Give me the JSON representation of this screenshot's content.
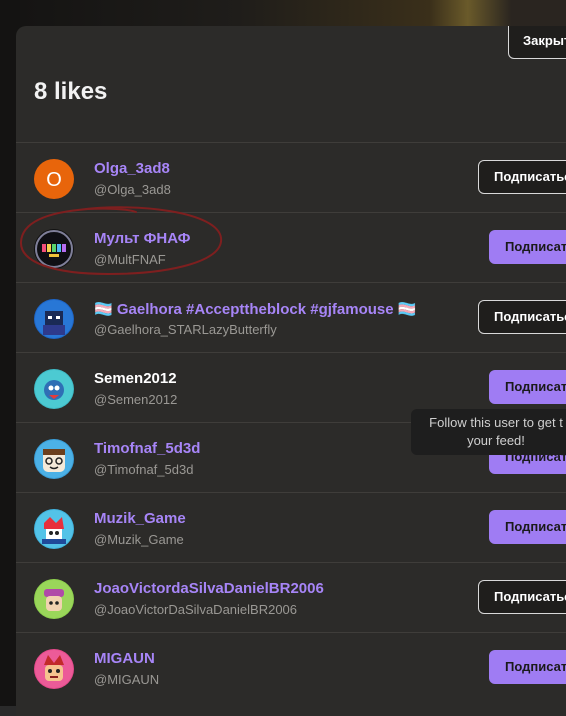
{
  "modal": {
    "close_label": "Закрыть",
    "title": "8 likes"
  },
  "users": [
    {
      "name": "Olga_3ad8",
      "handle": "@Olga_3ad8",
      "follow_label": "Подписаться",
      "follow_style": "outline",
      "avatar": "letter-o-avatar",
      "avatar_letter": "O"
    },
    {
      "name": "Мульт ФНАФ",
      "handle": "@MultFNAF",
      "follow_label": "Подписаться",
      "follow_style": "filled",
      "avatar": "mult-logo-avatar",
      "avatar_text": "MULT"
    },
    {
      "name": "🏳️‍⚧️ Gaelhora #Accepttheblock #gjfamouse 🏳️‍⚧️",
      "handle": "@Gaelhora_STARLazyButterfly",
      "follow_label": "Подписаться",
      "follow_style": "outline",
      "avatar": "character-avatar"
    },
    {
      "name": "Semen2012",
      "handle": "@Semen2012",
      "follow_label": "Подписаться",
      "follow_style": "filled",
      "avatar": "character-avatar"
    },
    {
      "name": "Timofnaf_5d3d",
      "handle": "@Timofnaf_5d3d",
      "follow_label": "Подписаться",
      "follow_style": "filled",
      "avatar": "character-avatar"
    },
    {
      "name": "Muzik_Game",
      "handle": "@Muzik_Game",
      "follow_label": "Подписаться",
      "follow_style": "filled",
      "avatar": "character-avatar"
    },
    {
      "name": "JoaoVictordaSilvaDanielBR2006",
      "handle": "@JoaoVictorDaSilvaDanielBR2006",
      "follow_label": "Подписаться",
      "follow_style": "outline",
      "avatar": "character-avatar"
    },
    {
      "name": "MIGAUN",
      "handle": "@MIGAUN",
      "follow_label": "Подписаться",
      "follow_style": "filled",
      "avatar": "character-avatar"
    }
  ],
  "tooltip": {
    "line1": "Follow this user to get t",
    "line2": "your feed!"
  },
  "colors": {
    "accent": "#a785f7",
    "button_fill": "#9f7cf3",
    "modal_bg": "#2c2b29",
    "annotation": "#8b1e1e"
  }
}
